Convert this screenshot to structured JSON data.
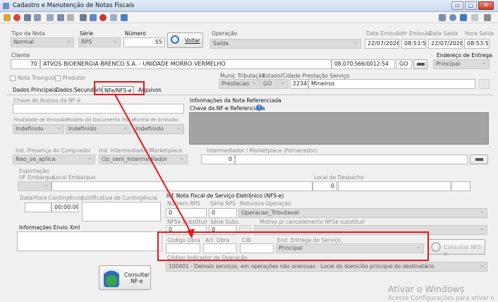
{
  "window": {
    "title": "Cadastro e Manutenção de Notas Fiscais",
    "minimize": "▭",
    "maximize": "▢",
    "close": "✕"
  },
  "header": {
    "tipo_nota_label": "Tipo da Nota",
    "tipo_nota": "Normal",
    "serie_label": "Série",
    "serie": "RPS",
    "numero_label": "Número",
    "numero": "55",
    "voltar_label": "Voltar",
    "operacao_label": "Operação",
    "operacao": "Saída",
    "data_emissao_label": "Data Emissão",
    "data_emissao": "22/07/2026",
    "hr_emissao_label": "Hr Emissão",
    "hr_emissao": "08:53:55",
    "data_saida_label": "Data Saída",
    "data_saida": "22/07/2026",
    "hora_saida_label": "Hora Saída",
    "hora_saida": "08:53:55"
  },
  "cliente": {
    "label": "Cliente",
    "codigo": "70",
    "nome": "ATVOS BIOENERGIA BRENCO S.A. - UNIDADE MORRO VERMELHO",
    "cnpj": "08.070.566/0012-54",
    "uf": "GO",
    "endereco_entrega_label": "Endereço de Entrega",
    "endereco_entrega": "Principal"
  },
  "flags": {
    "nota_triangular": "Nota Triangular",
    "produtor": "Produtor"
  },
  "municipio": {
    "tributacao_label": "Munic Tributação",
    "tributacao": "Prestacao",
    "estado_label": "Estado/Cidade Prestação Serviço",
    "estado": "GO",
    "cidade_codigo": "2234",
    "cidade": "Mineiros"
  },
  "tabs": [
    {
      "label": "Dados Principais"
    },
    {
      "label": "Dados Secundários"
    },
    {
      "label": "NFe/NFS-e"
    },
    {
      "label": "Arquivos"
    }
  ],
  "nfe": {
    "chave_label": "Chave de Acesso da NF-e",
    "finalidade_label": "Finalidade de Emissão",
    "finalidade": "Indefinido",
    "modelo_label": "Modelo do Documento Fiscal",
    "modelo": "Indefinido",
    "forma_label": "Forma de Emissão",
    "forma": "Indefinido",
    "ref_title": "Informações da Nota Referenciada",
    "ref_chave_label": "Chave da NF-e Referenciada",
    "presenca_label": "Ind. Presença do Comprador",
    "presenca": "Nao_se_aplica",
    "intermediador_label": "Ind. Intermediador/Marketplace",
    "intermediador": "Op_sem_Intermediador",
    "intermediador_fornecedor_label": "Intermediador / Marketplace (Fornecedor)",
    "intermediador_codigo": "0",
    "exportacao_label": "Exportação",
    "uf_embarque_label": "UF Embarque",
    "local_embarque_label": "Local Embarque",
    "local_despacho_label": "Local de Despacho",
    "local_despacho": "0",
    "contingencia_data_label": "Data/Hora Contingência",
    "contingencia_hora": "00:00:00",
    "contingencia_just_label": "Justificativa de Contingência",
    "info_envio_label": "Informações Envio Xml",
    "consultar_nfe_label": "Consultar NF-e"
  },
  "nfse": {
    "title": "Inf. Nota Fiscal de Serviço Eletrônico (NFS-e)",
    "numero_rps_label": "Número RPS",
    "numero_rps": "0",
    "serie_rps_label": "Série RPS",
    "serie_rps": "0",
    "natureza_label": "Natureza Operação",
    "natureza": "Operacao_Tributavel",
    "substituir_label": "NFSe Substituir",
    "substituir": "0",
    "serie_subs_label": "Série Subs.",
    "serie_subs": "0",
    "motivo_label": "Motivo p/ cancelamento NFSe substituir",
    "codigo_obra_label": "Código Obra",
    "art_obra_label": "Art. Obra",
    "cib_label": "CIB",
    "end_entrega_label": "End. Entrega do Serviço",
    "end_entrega": "Principal",
    "consultar_nfse_label": "Consultar NFS-e",
    "indicador_label": "Código Indicador de Operação",
    "indicador": "100401 - Demais serviços, em operações não onerosas - Local do domicílio principal do destinatário"
  },
  "watermark": {
    "line1": "Ativar o Windows",
    "line2": "Acesse Configurações para ativar o"
  },
  "colors": {
    "highlight": "#e4161b",
    "accent": "#2a6fc9"
  }
}
